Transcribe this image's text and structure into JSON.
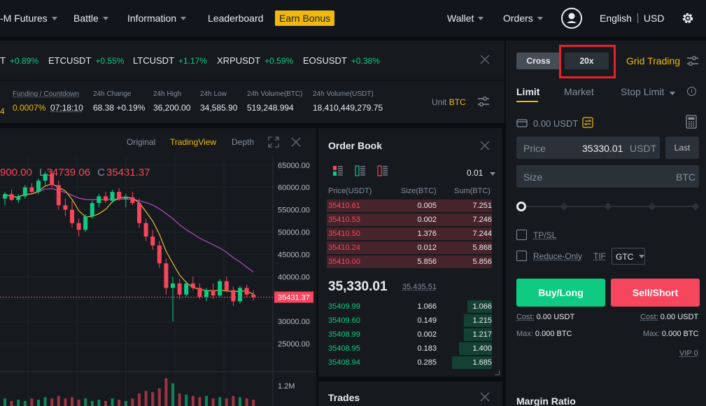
{
  "nav": {
    "futures": "-M Futures",
    "battle": "Battle",
    "information": "Information",
    "leaderboard": "Leaderboard",
    "earn_bonus": "Earn Bonus",
    "wallet": "Wallet",
    "orders": "Orders",
    "language": "English",
    "currency": "USD"
  },
  "tickers": [
    {
      "symbol": "T",
      "change": "+0.89%"
    },
    {
      "symbol": "ETCUSDT",
      "change": "+0.55%"
    },
    {
      "symbol": "LTCUSDT",
      "change": "+1.17%"
    },
    {
      "symbol": "XRPUSDT",
      "change": "+0.59%"
    },
    {
      "symbol": "EOSUSDT",
      "change": "+0.38%"
    }
  ],
  "stats": {
    "funding_label": "Funding / Countdown",
    "funding_rate": "0.0007%",
    "countdown": "07:18:10",
    "change_label": "24h Change",
    "change_value": "68.38 +0.19%",
    "high_label": "24h High",
    "high_value": "36,200.00",
    "low_label": "24h Low",
    "low_value": "34,585.90",
    "vol_btc_label": "24h Volume(BTC)",
    "vol_btc_value": "519,248.994",
    "vol_usdt_label": "24h Volume(USDT)",
    "vol_usdt_value": "18,410,449,279.75",
    "unit_label": "Unit",
    "unit_value": "BTC",
    "left_fragment": "4"
  },
  "chart_tabs": {
    "original": "Original",
    "tradingview": "TradingView",
    "depth": "Depth"
  },
  "ohlc": {
    "high": "900.00",
    "low_prefix": "L",
    "low": "34739.06",
    "close_prefix": "C",
    "close": "35431.37"
  },
  "chart_data": {
    "type": "candlestick",
    "y_ticks": [
      "65000.00",
      "60000.00",
      "55000.00",
      "50000.00",
      "45000.00",
      "40000.00",
      "30000.00",
      "25000.00"
    ],
    "ylim": [
      20000,
      67000
    ],
    "current_price": "35431.37",
    "volume_tick": "1.2M",
    "candles": [
      {
        "o": 57500,
        "h": 59000,
        "l": 56000,
        "c": 58500
      },
      {
        "o": 58500,
        "h": 59500,
        "l": 57000,
        "c": 57200
      },
      {
        "o": 57200,
        "h": 58500,
        "l": 56500,
        "c": 58000
      },
      {
        "o": 58000,
        "h": 60500,
        "l": 57500,
        "c": 60000
      },
      {
        "o": 60000,
        "h": 61000,
        "l": 58500,
        "c": 59000
      },
      {
        "o": 59000,
        "h": 62000,
        "l": 58500,
        "c": 61500
      },
      {
        "o": 61500,
        "h": 63500,
        "l": 60500,
        "c": 63000
      },
      {
        "o": 63000,
        "h": 64000,
        "l": 60000,
        "c": 60500
      },
      {
        "o": 60500,
        "h": 61500,
        "l": 55000,
        "c": 56000
      },
      {
        "o": 56000,
        "h": 57500,
        "l": 53500,
        "c": 55000
      },
      {
        "o": 55000,
        "h": 57000,
        "l": 51000,
        "c": 52000
      },
      {
        "o": 52000,
        "h": 53000,
        "l": 49000,
        "c": 50500
      },
      {
        "o": 50500,
        "h": 54000,
        "l": 50000,
        "c": 53500
      },
      {
        "o": 53500,
        "h": 57000,
        "l": 53000,
        "c": 56500
      },
      {
        "o": 56500,
        "h": 58500,
        "l": 55500,
        "c": 58000
      },
      {
        "o": 58000,
        "h": 59000,
        "l": 56500,
        "c": 57000
      },
      {
        "o": 57000,
        "h": 59500,
        "l": 56500,
        "c": 59000
      },
      {
        "o": 59000,
        "h": 59800,
        "l": 57000,
        "c": 57500
      },
      {
        "o": 57500,
        "h": 58500,
        "l": 55500,
        "c": 57800
      },
      {
        "o": 57800,
        "h": 59000,
        "l": 56000,
        "c": 56500
      },
      {
        "o": 56500,
        "h": 57500,
        "l": 51000,
        "c": 52000
      },
      {
        "o": 52000,
        "h": 53000,
        "l": 48000,
        "c": 49000
      },
      {
        "o": 49000,
        "h": 50500,
        "l": 46000,
        "c": 47000
      },
      {
        "o": 47000,
        "h": 48000,
        "l": 42000,
        "c": 43000
      },
      {
        "o": 43000,
        "h": 44000,
        "l": 36000,
        "c": 37500
      },
      {
        "o": 37500,
        "h": 40000,
        "l": 30000,
        "c": 38500
      },
      {
        "o": 38500,
        "h": 39500,
        "l": 35000,
        "c": 36000
      },
      {
        "o": 36000,
        "h": 39000,
        "l": 35500,
        "c": 38500
      },
      {
        "o": 38500,
        "h": 40000,
        "l": 37000,
        "c": 37500
      },
      {
        "o": 37500,
        "h": 38500,
        "l": 35000,
        "c": 35500
      },
      {
        "o": 35500,
        "h": 37500,
        "l": 34500,
        "c": 37000
      },
      {
        "o": 37000,
        "h": 38500,
        "l": 35000,
        "c": 35800
      },
      {
        "o": 35800,
        "h": 39500,
        "l": 35500,
        "c": 39000
      },
      {
        "o": 39000,
        "h": 40000,
        "l": 36500,
        "c": 37000
      },
      {
        "o": 37000,
        "h": 37800,
        "l": 33500,
        "c": 34500
      },
      {
        "o": 34500,
        "h": 38000,
        "l": 34000,
        "c": 37500
      },
      {
        "o": 37500,
        "h": 38200,
        "l": 35500,
        "c": 36000
      },
      {
        "o": 36000,
        "h": 37000,
        "l": 34739,
        "c": 35431
      }
    ],
    "volumes": [
      0.3,
      0.2,
      0.25,
      0.2,
      0.3,
      0.25,
      0.35,
      0.3,
      0.4,
      0.3,
      0.35,
      0.25,
      0.3,
      0.2,
      0.25,
      0.2,
      0.3,
      0.25,
      0.2,
      0.3,
      0.5,
      0.6,
      0.55,
      0.7,
      1.1,
      0.9,
      0.5,
      0.45,
      0.4,
      0.35,
      0.4,
      0.3,
      0.35,
      0.3,
      0.4,
      0.35,
      0.3,
      0.25
    ]
  },
  "orderbook": {
    "title": "Order Book",
    "precision": "0.01",
    "col_price": "Price(USDT)",
    "col_size": "Size(BTC)",
    "col_sum": "Sum(BTC)",
    "asks": [
      {
        "price": "35410.61",
        "size": "0.005",
        "sum": "7.251",
        "depth": 1.0
      },
      {
        "price": "35410.53",
        "size": "0.002",
        "sum": "7.246",
        "depth": 1.0
      },
      {
        "price": "35410.50",
        "size": "1.376",
        "sum": "7.244",
        "depth": 1.0
      },
      {
        "price": "35410.24",
        "size": "0.012",
        "sum": "5.868",
        "depth": 1.0
      },
      {
        "price": "35410.00",
        "size": "5.856",
        "sum": "5.856",
        "depth": 1.0
      }
    ],
    "last_price": "35,330.01",
    "mark_price": "35,435.51",
    "bids": [
      {
        "price": "35409.99",
        "size": "1.066",
        "sum": "1.066",
        "depth": 0.15
      },
      {
        "price": "35409.60",
        "size": "0.149",
        "sum": "1.215",
        "depth": 0.17
      },
      {
        "price": "35408.99",
        "size": "0.002",
        "sum": "1.217",
        "depth": 0.17
      },
      {
        "price": "35408.95",
        "size": "0.183",
        "sum": "1.400",
        "depth": 0.2
      },
      {
        "price": "35408.94",
        "size": "0.285",
        "sum": "1.685",
        "depth": 0.24
      }
    ]
  },
  "trades": {
    "title": "Trades"
  },
  "trade": {
    "margin_mode": "Cross",
    "leverage": "20x",
    "grid_trading": "Grid Trading",
    "tab_limit": "Limit",
    "tab_market": "Market",
    "tab_stop_limit": "Stop Limit",
    "balance": "0.00 USDT",
    "price_label": "Price",
    "price_value": "35330.01",
    "price_unit": "USDT",
    "last_button": "Last",
    "size_label": "Size",
    "size_unit": "BTC",
    "tpsl": "TP/SL",
    "reduce_only": "Reduce-Only",
    "tif_label": "TIF",
    "tif_value": "GTC",
    "buy_label": "Buy/Long",
    "sell_label": "Sell/Short",
    "cost_label": "Cost:",
    "cost_buy": "0.00 USDT",
    "cost_sell": "0.00 USDT",
    "max_label": "Max:",
    "max_buy": "0.000 BTC",
    "max_sell": "0.000 BTC",
    "vip": "VIP 0",
    "margin_ratio": "Margin Ratio"
  },
  "colors": {
    "accent": "#f0b90b",
    "buy": "#0ecb81",
    "sell": "#f6465d",
    "highlight_box": "#e6232a"
  }
}
